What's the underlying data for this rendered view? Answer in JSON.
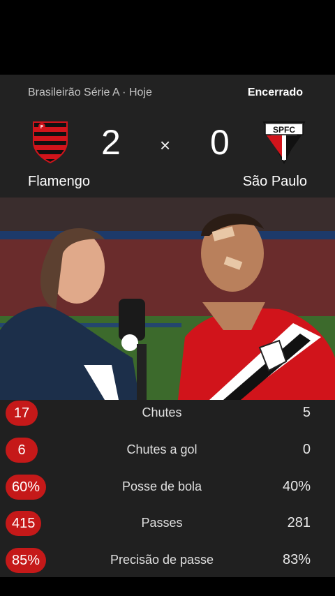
{
  "match": {
    "competition": "Brasileirão Série A · Hoje",
    "status": "Encerrado",
    "score_separator": "×",
    "home": {
      "name": "Flamengo",
      "score": "2",
      "crest_text": "",
      "colors": [
        "#d1141b",
        "#111111"
      ]
    },
    "away": {
      "name": "São Paulo",
      "score": "0",
      "crest_text": "SPFC",
      "colors": [
        "#ffffff",
        "#d1141b",
        "#111111"
      ]
    }
  },
  "media": {
    "description_icon": "post-match-interview-image"
  },
  "stats": [
    {
      "home": "17",
      "label": "Chutes",
      "away": "5"
    },
    {
      "home": "6",
      "label": "Chutes a gol",
      "away": "0"
    },
    {
      "home": "60%",
      "label": "Posse de bola",
      "away": "40%"
    },
    {
      "home": "415",
      "label": "Passes",
      "away": "281"
    },
    {
      "home": "85%",
      "label": "Precisão de passe",
      "away": "83%"
    }
  ],
  "theme": {
    "accent": "#c51919",
    "card_bg": "#222222",
    "stats_bg": "#202020"
  }
}
